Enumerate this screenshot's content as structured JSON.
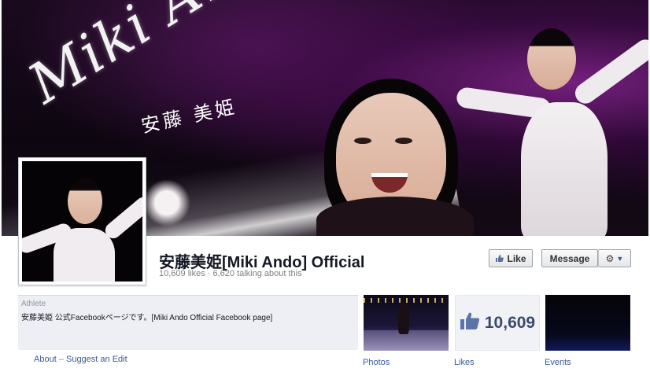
{
  "cover": {
    "title": "Miki Ando",
    "kanji": "安藤 美姫"
  },
  "page": {
    "name": "安藤美姫[Miki Ando] Official",
    "stats": "10,609 likes · 6,620 talking about this"
  },
  "actions": {
    "like_label": "Like",
    "message_label": "Message",
    "gear_icon": "gear-icon",
    "chevron_icon": "chevron-down-icon"
  },
  "info": {
    "category": "Athlete",
    "description": "安藤美姫 公式Facebookページです。[Miki Ando Official Facebook page]",
    "about_link": "About",
    "separator": " – ",
    "suggest_link": "Suggest an Edit"
  },
  "apps": {
    "photos_label": "Photos",
    "likes_label": "Likes",
    "likes_count": "10,609",
    "events_label": "Events"
  },
  "colors": {
    "link": "#3b5998",
    "info_bg": "#edeff4"
  }
}
